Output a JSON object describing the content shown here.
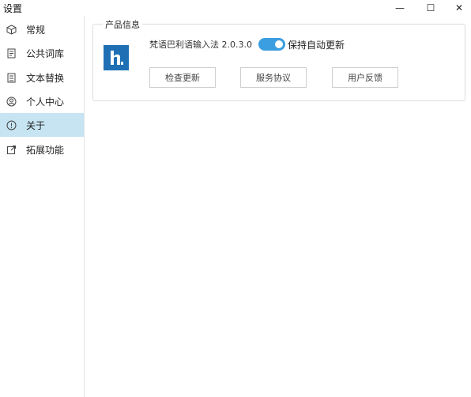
{
  "window": {
    "title": "设置",
    "minimize": "—",
    "maximize": "☐",
    "close": "✕"
  },
  "sidebar": {
    "items": [
      {
        "label": "常规",
        "icon": "cube-icon"
      },
      {
        "label": "公共词库",
        "icon": "book-icon"
      },
      {
        "label": "文本替换",
        "icon": "document-icon"
      },
      {
        "label": "个人中心",
        "icon": "user-icon"
      },
      {
        "label": "关于",
        "icon": "info-icon",
        "active": true
      },
      {
        "label": "拓展功能",
        "icon": "external-link-icon"
      }
    ]
  },
  "about": {
    "group_title": "产品信息",
    "product_name": "梵语巴利语输入法 2.0.3.0",
    "auto_update_label": "保持自动更新",
    "auto_update_on": true,
    "buttons": {
      "check_update": "检查更新",
      "service_agreement": "服务协议",
      "feedback": "用户反馈"
    }
  },
  "colors": {
    "accent": "#3a9ee0",
    "active_nav": "#c6e4f2",
    "logo_bg": "#1f6fb5"
  }
}
